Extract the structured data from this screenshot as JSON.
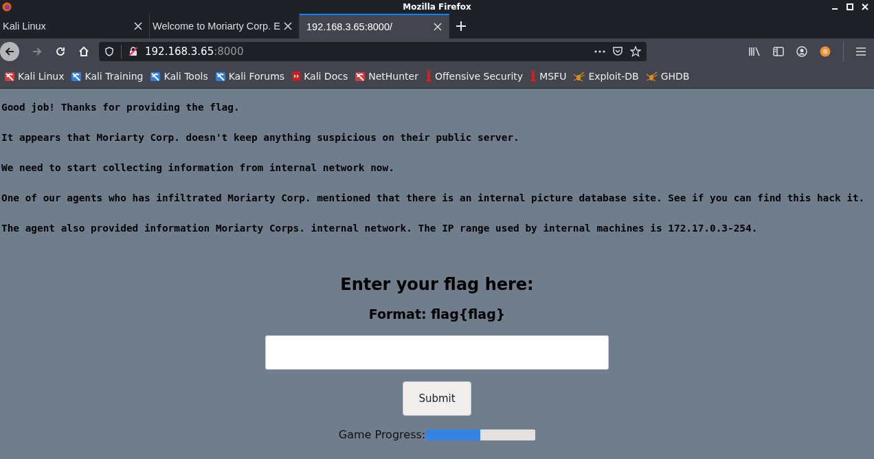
{
  "window": {
    "title": "Mozilla Firefox"
  },
  "tabs": [
    {
      "label": "Kali Linux",
      "selected": false
    },
    {
      "label": "Welcome to Moriarty Corp. E",
      "selected": false
    },
    {
      "label": "192.168.3.65:8000/",
      "selected": true
    }
  ],
  "address_bar": {
    "host": "192.168.3.65",
    "port": ":8000"
  },
  "bookmarks": [
    {
      "label": "Kali Linux",
      "kind": "kali"
    },
    {
      "label": "Kali Training",
      "kind": "kalib"
    },
    {
      "label": "Kali Tools",
      "kind": "kalib"
    },
    {
      "label": "Kali Forums",
      "kind": "kalib"
    },
    {
      "label": "Kali Docs",
      "kind": "docs"
    },
    {
      "label": "NetHunter",
      "kind": "kali"
    },
    {
      "label": "Offensive Security",
      "kind": "offsec"
    },
    {
      "label": "MSFU",
      "kind": "offsec"
    },
    {
      "label": "Exploit-DB",
      "kind": "spider"
    },
    {
      "label": "GHDB",
      "kind": "spider"
    }
  ],
  "messages": [
    "Good job! Thanks for providing the flag.",
    "It appears that Moriarty Corp. doesn't keep anything suspicious on their public server.",
    "We need to start collecting information from internal network now.",
    "One of our agents who has infiltrated Moriarty Corp. mentioned that there is an internal picture database site. See if you can find this hack it.",
    "The agent also provided information Moriarty Corps. internal network. The IP range used by internal machines is 172.17.0.3-254."
  ],
  "form": {
    "heading": "Enter your flag here:",
    "format": "Format: flag{flag}",
    "submit": "Submit"
  },
  "progress": {
    "label": "Game Progress:",
    "level": 0.5
  }
}
